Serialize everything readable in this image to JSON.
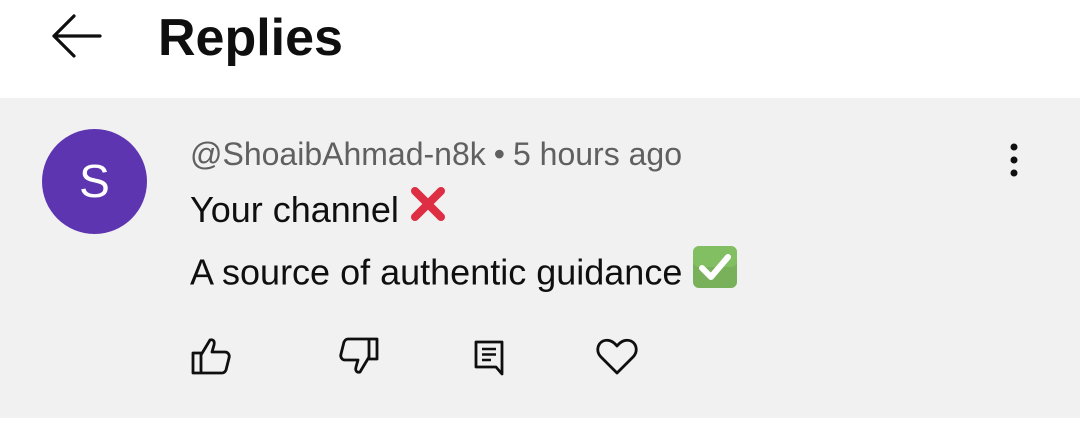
{
  "header": {
    "title": "Replies",
    "back_icon": "back-arrow-icon"
  },
  "comment": {
    "avatar_letter": "S",
    "avatar_color": "#5e35b1",
    "author": "@ShoaibAhmad-n8k",
    "separator": "•",
    "time": "5 hours ago",
    "line1_text": "Your channel",
    "line1_emoji": "cross-mark-emoji",
    "line2_text": "A source of authentic guidance",
    "line2_emoji": "check-mark-button-emoji",
    "more_icon": "more-vertical-icon"
  },
  "actions": {
    "like_icon": "thumbs-up-icon",
    "dislike_icon": "thumbs-down-icon",
    "reply_icon": "reply-comment-icon",
    "heart_icon": "heart-icon"
  },
  "colors": {
    "background": "#ffffff",
    "comment_background": "#f1f1f1",
    "secondary_text": "#606060",
    "primary_text": "#0f0f0f",
    "cross_red": "#dd2e44",
    "check_green": "#78b159"
  }
}
